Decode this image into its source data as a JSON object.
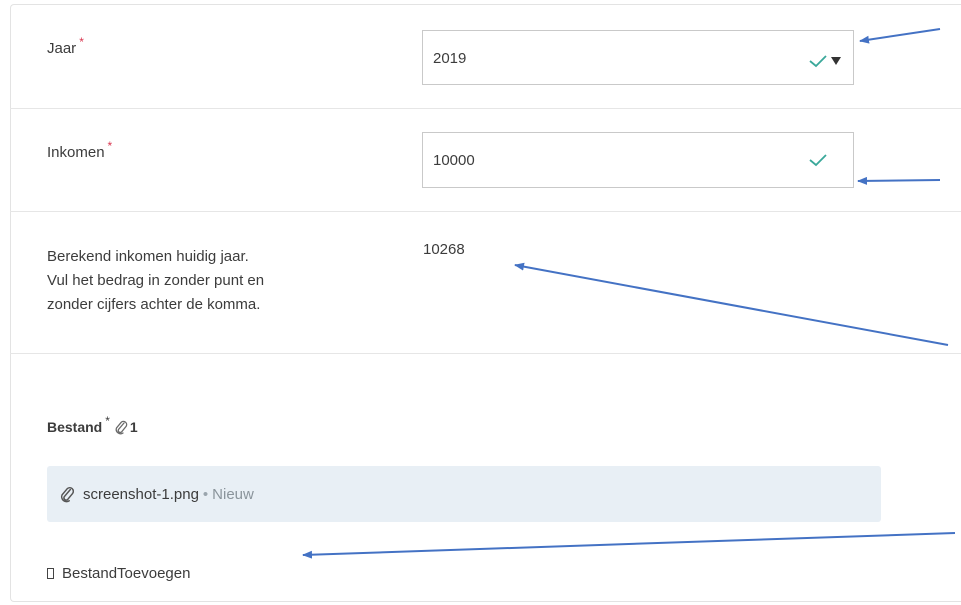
{
  "form": {
    "year": {
      "label": "Jaar",
      "required_mark": "*",
      "selected_value": "2019"
    },
    "income": {
      "label": "Inkomen",
      "required_mark": "*",
      "value": "10000"
    },
    "calculated_income": {
      "help_lines": [
        "Berekend inkomen huidig jaar.",
        "Vul het bedrag in zonder punt en",
        "zonder cijfers achter de komma."
      ],
      "value": "10268"
    },
    "file": {
      "label": "Bestand",
      "required_mark": "*",
      "count": "1",
      "attachments": [
        {
          "filename": "screenshot-1.png",
          "separator": "•",
          "status": "Nieuw"
        }
      ],
      "add_button_label": "BestandToevoegen"
    }
  },
  "colors": {
    "valid_check": "#3aa89a",
    "required_star": "#d9364f",
    "annotation_arrow": "#4472c4",
    "attachment_bg": "#e8eff5"
  },
  "icons": {
    "year_valid": "check-icon",
    "year_dropdown": "caret-down-icon",
    "income_valid": "check-icon",
    "attachment": "paperclip-icon",
    "add_file": "square-glyph-icon"
  }
}
